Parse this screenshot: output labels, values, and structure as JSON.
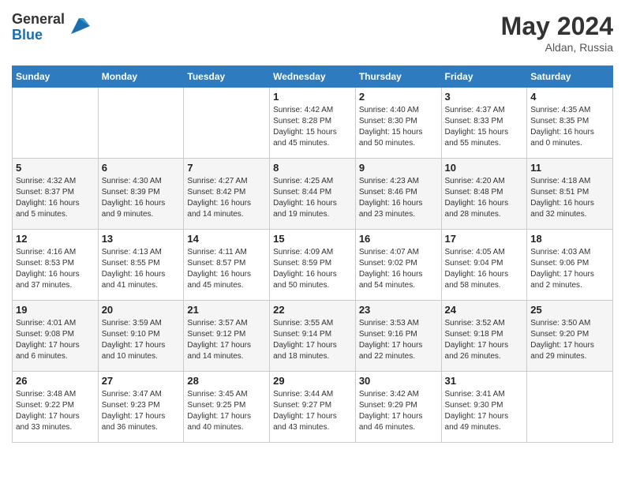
{
  "header": {
    "logo_general": "General",
    "logo_blue": "Blue",
    "month_year": "May 2024",
    "location": "Aldan, Russia"
  },
  "days_of_week": [
    "Sunday",
    "Monday",
    "Tuesday",
    "Wednesday",
    "Thursday",
    "Friday",
    "Saturday"
  ],
  "weeks": [
    [
      {
        "day": "",
        "info": ""
      },
      {
        "day": "",
        "info": ""
      },
      {
        "day": "",
        "info": ""
      },
      {
        "day": "1",
        "info": "Sunrise: 4:42 AM\nSunset: 8:28 PM\nDaylight: 15 hours\nand 45 minutes."
      },
      {
        "day": "2",
        "info": "Sunrise: 4:40 AM\nSunset: 8:30 PM\nDaylight: 15 hours\nand 50 minutes."
      },
      {
        "day": "3",
        "info": "Sunrise: 4:37 AM\nSunset: 8:33 PM\nDaylight: 15 hours\nand 55 minutes."
      },
      {
        "day": "4",
        "info": "Sunrise: 4:35 AM\nSunset: 8:35 PM\nDaylight: 16 hours\nand 0 minutes."
      }
    ],
    [
      {
        "day": "5",
        "info": "Sunrise: 4:32 AM\nSunset: 8:37 PM\nDaylight: 16 hours\nand 5 minutes."
      },
      {
        "day": "6",
        "info": "Sunrise: 4:30 AM\nSunset: 8:39 PM\nDaylight: 16 hours\nand 9 minutes."
      },
      {
        "day": "7",
        "info": "Sunrise: 4:27 AM\nSunset: 8:42 PM\nDaylight: 16 hours\nand 14 minutes."
      },
      {
        "day": "8",
        "info": "Sunrise: 4:25 AM\nSunset: 8:44 PM\nDaylight: 16 hours\nand 19 minutes."
      },
      {
        "day": "9",
        "info": "Sunrise: 4:23 AM\nSunset: 8:46 PM\nDaylight: 16 hours\nand 23 minutes."
      },
      {
        "day": "10",
        "info": "Sunrise: 4:20 AM\nSunset: 8:48 PM\nDaylight: 16 hours\nand 28 minutes."
      },
      {
        "day": "11",
        "info": "Sunrise: 4:18 AM\nSunset: 8:51 PM\nDaylight: 16 hours\nand 32 minutes."
      }
    ],
    [
      {
        "day": "12",
        "info": "Sunrise: 4:16 AM\nSunset: 8:53 PM\nDaylight: 16 hours\nand 37 minutes."
      },
      {
        "day": "13",
        "info": "Sunrise: 4:13 AM\nSunset: 8:55 PM\nDaylight: 16 hours\nand 41 minutes."
      },
      {
        "day": "14",
        "info": "Sunrise: 4:11 AM\nSunset: 8:57 PM\nDaylight: 16 hours\nand 45 minutes."
      },
      {
        "day": "15",
        "info": "Sunrise: 4:09 AM\nSunset: 8:59 PM\nDaylight: 16 hours\nand 50 minutes."
      },
      {
        "day": "16",
        "info": "Sunrise: 4:07 AM\nSunset: 9:02 PM\nDaylight: 16 hours\nand 54 minutes."
      },
      {
        "day": "17",
        "info": "Sunrise: 4:05 AM\nSunset: 9:04 PM\nDaylight: 16 hours\nand 58 minutes."
      },
      {
        "day": "18",
        "info": "Sunrise: 4:03 AM\nSunset: 9:06 PM\nDaylight: 17 hours\nand 2 minutes."
      }
    ],
    [
      {
        "day": "19",
        "info": "Sunrise: 4:01 AM\nSunset: 9:08 PM\nDaylight: 17 hours\nand 6 minutes."
      },
      {
        "day": "20",
        "info": "Sunrise: 3:59 AM\nSunset: 9:10 PM\nDaylight: 17 hours\nand 10 minutes."
      },
      {
        "day": "21",
        "info": "Sunrise: 3:57 AM\nSunset: 9:12 PM\nDaylight: 17 hours\nand 14 minutes."
      },
      {
        "day": "22",
        "info": "Sunrise: 3:55 AM\nSunset: 9:14 PM\nDaylight: 17 hours\nand 18 minutes."
      },
      {
        "day": "23",
        "info": "Sunrise: 3:53 AM\nSunset: 9:16 PM\nDaylight: 17 hours\nand 22 minutes."
      },
      {
        "day": "24",
        "info": "Sunrise: 3:52 AM\nSunset: 9:18 PM\nDaylight: 17 hours\nand 26 minutes."
      },
      {
        "day": "25",
        "info": "Sunrise: 3:50 AM\nSunset: 9:20 PM\nDaylight: 17 hours\nand 29 minutes."
      }
    ],
    [
      {
        "day": "26",
        "info": "Sunrise: 3:48 AM\nSunset: 9:22 PM\nDaylight: 17 hours\nand 33 minutes."
      },
      {
        "day": "27",
        "info": "Sunrise: 3:47 AM\nSunset: 9:23 PM\nDaylight: 17 hours\nand 36 minutes."
      },
      {
        "day": "28",
        "info": "Sunrise: 3:45 AM\nSunset: 9:25 PM\nDaylight: 17 hours\nand 40 minutes."
      },
      {
        "day": "29",
        "info": "Sunrise: 3:44 AM\nSunset: 9:27 PM\nDaylight: 17 hours\nand 43 minutes."
      },
      {
        "day": "30",
        "info": "Sunrise: 3:42 AM\nSunset: 9:29 PM\nDaylight: 17 hours\nand 46 minutes."
      },
      {
        "day": "31",
        "info": "Sunrise: 3:41 AM\nSunset: 9:30 PM\nDaylight: 17 hours\nand 49 minutes."
      },
      {
        "day": "",
        "info": ""
      }
    ]
  ]
}
